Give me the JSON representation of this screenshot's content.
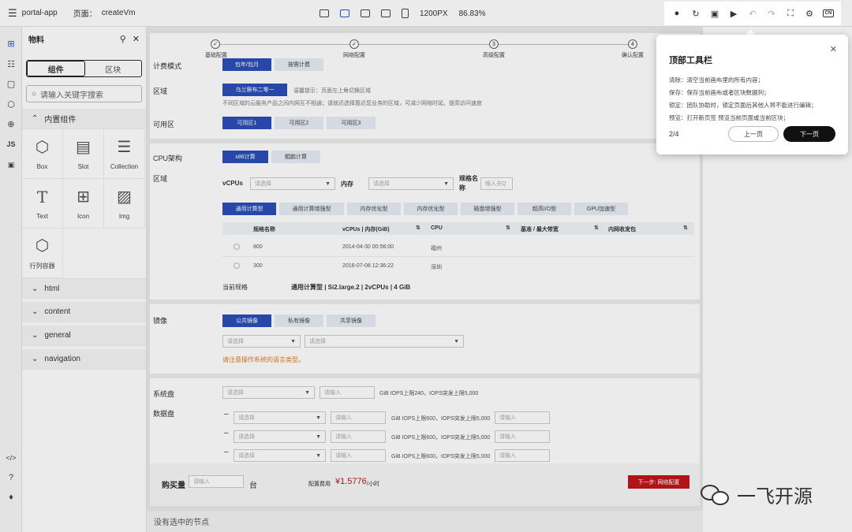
{
  "topbar": {
    "app_name": "portal-app",
    "page_label": "页面：",
    "page_name": "createVm",
    "viewport": "1200PX",
    "zoom": "86.83%",
    "lang_badge": "CN"
  },
  "materials": {
    "title": "物料",
    "tab_components": "组件",
    "tab_blocks": "区块",
    "search_placeholder": "请输入关键字搜索",
    "builtin_group": "内置组件",
    "components": [
      {
        "label": "Box",
        "icon": "cube-icon"
      },
      {
        "label": "Slot",
        "icon": "slot-icon"
      },
      {
        "label": "Collection",
        "icon": "collection-icon"
      },
      {
        "label": "Text",
        "icon": "text-icon"
      },
      {
        "label": "Icon",
        "icon": "grid-icon"
      },
      {
        "label": "Img",
        "icon": "image-icon"
      },
      {
        "label": "行列容器",
        "icon": "cube-icon"
      }
    ],
    "groups": [
      "html",
      "content",
      "general",
      "navigation"
    ]
  },
  "form": {
    "steps": [
      "基础配置",
      "网络配置",
      "高级配置",
      "确认配置"
    ],
    "billing_label": "计费模式",
    "billing_options": [
      "包年/包月",
      "按需计费"
    ],
    "region_label": "区域",
    "region_value": "乌兰察布二零一",
    "region_hint": "温馨提示：页面左上角切换区域",
    "region_hint2": "不同区域的云服务产品之间内网互不相通；请就近选择靠近您业务的区域，可减少网络时延、提高访问速度",
    "az_label": "可用区",
    "az_options": [
      "可用区1",
      "可用区2",
      "可用区3"
    ],
    "cpu_arch_label": "CPU架构",
    "cpu_arch_options": [
      "x86计算",
      "鲲鹏计算"
    ],
    "zone_label": "区域",
    "vcpus_label": "vCPUs",
    "select_placeholder": "请选择",
    "memory_label": "内存",
    "spec_name_label": "规格名称",
    "input_placeholder": "输入关Q",
    "spec_tabs": [
      "通用计算型",
      "通用计算增强型",
      "内存优化型",
      "内存优化型",
      "磁盘增强型",
      "超高I/O型",
      "GPU加速型"
    ],
    "table_headers": [
      "规格名称",
      "vCPUs | 内存(GiB)",
      "CPU",
      "基准 / 最大带宽",
      "内网收发包"
    ],
    "table_rows": [
      {
        "name": "800",
        "time": "2014-04-30 00:56:00",
        "cpu": "福州"
      },
      {
        "name": "300",
        "time": "2016-07-08 12:36:22",
        "cpu": "深圳"
      }
    ],
    "current_spec_label": "当前规格",
    "current_spec_value": "通用计算型 | Si2.large.2 | 2vCPUs | 4 GiB",
    "image_label": "镜像",
    "image_options": [
      "公共镜像",
      "私有镜像",
      "共享镜像"
    ],
    "image_warning": "请注意操作系统的语言类型。",
    "sysdisk_label": "系统盘",
    "input_ph": "请输入",
    "sysdisk_hint": "GiB IOPS上限240，IOPS突发上限5,000",
    "datadisk_label": "数据盘",
    "datadisk_hint": "GiB IOPS上限600，IOPS突发上限5,000",
    "buy_label": "购买量",
    "buy_unit": "台",
    "fee_label": "配置费用",
    "fee_value": "¥1.5776",
    "fee_unit": "/小时",
    "next_button": "下一步: 网络配置"
  },
  "status": {
    "text": "没有选中的节点"
  },
  "tour": {
    "title": "顶部工具栏",
    "lines": [
      "清除：清空当前画布里的所有内容；",
      "保存：保存当前画布或者区块数据列；",
      "锁定：团队协助时，锁定页面后其他人将不能进行编辑；",
      "预览：打开新页签 预览当前页面或当前区块；"
    ],
    "page": "2/4",
    "prev": "上一页",
    "next": "下一页"
  },
  "watermark": {
    "text": "一飞开源"
  },
  "colors": {
    "primary": "#2b4fb8",
    "danger": "#c0161b",
    "warning": "#e07a1f",
    "accent": "#1e5bd8"
  }
}
